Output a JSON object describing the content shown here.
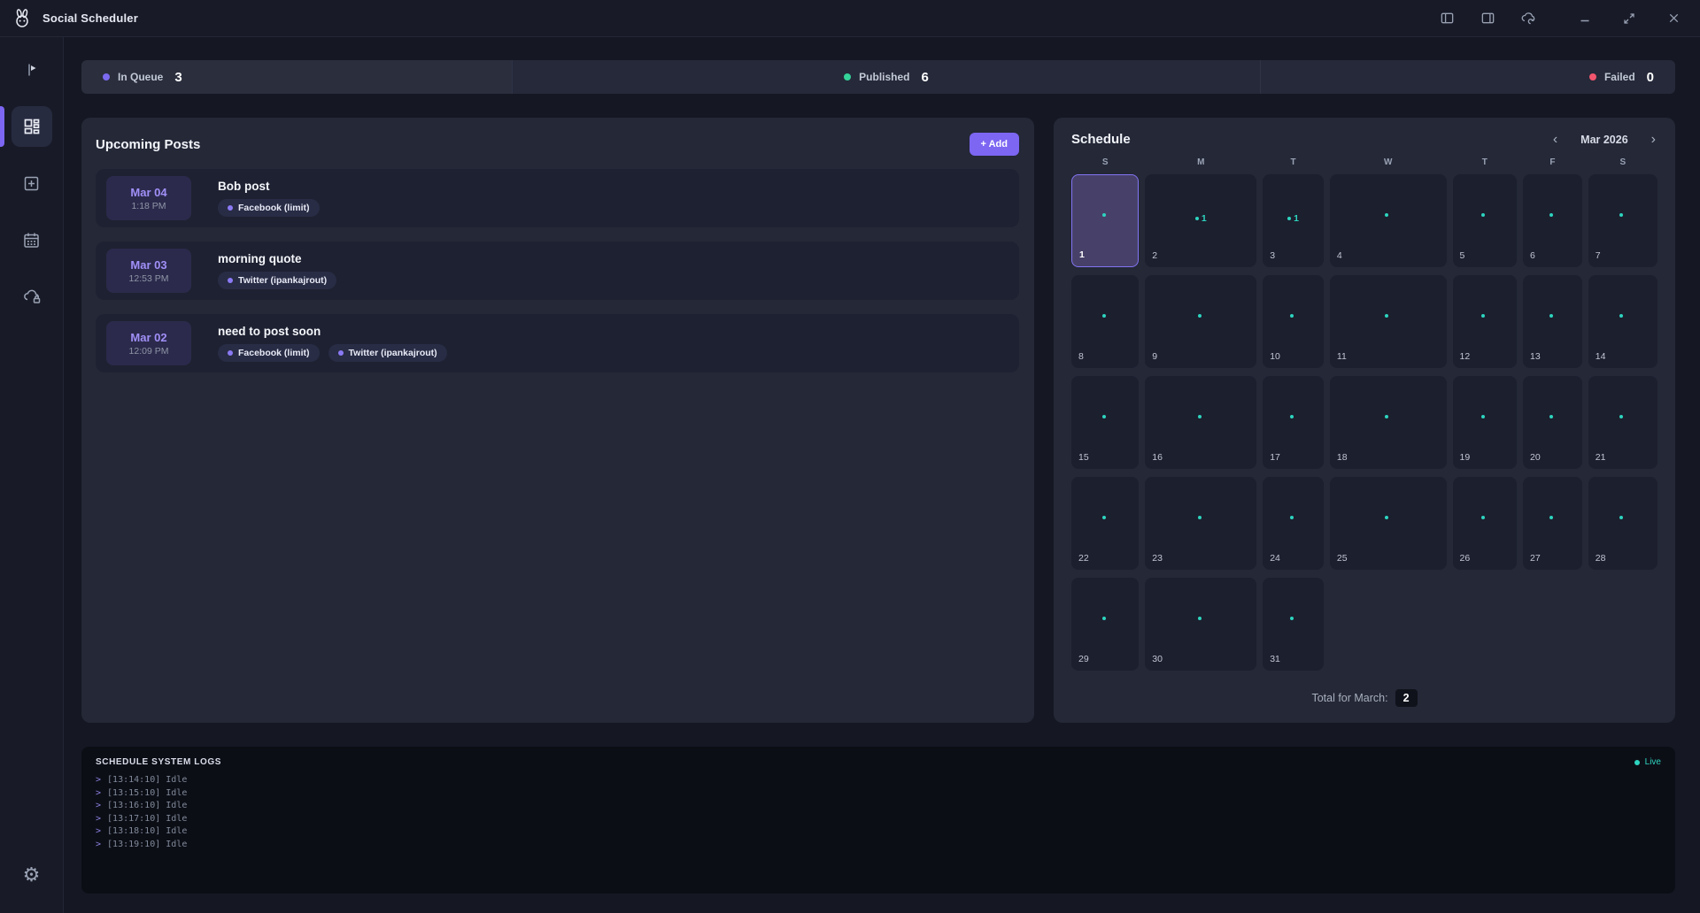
{
  "theme": {
    "accent": "#7c66f2",
    "queue_dot": "#7c6af0",
    "published_dot": "#34d399",
    "failed_dot": "#f2566e",
    "live_color": "#2dd4bf",
    "event_marker": "#2dd4bf"
  },
  "titlebar": {
    "app_title": "Social Scheduler"
  },
  "stats": {
    "items": [
      {
        "label": "In Queue",
        "value": "3"
      },
      {
        "label": "Published",
        "value": "6"
      },
      {
        "label": "Failed",
        "value": "0"
      }
    ]
  },
  "upcoming_posts": {
    "title": "Upcoming Posts",
    "add_button": "+ Add",
    "posts": [
      {
        "date": "Mar 04",
        "time": "1:18 PM",
        "title": "Bob post",
        "platforms": [
          "Facebook (limit)"
        ]
      },
      {
        "date": "Mar 03",
        "time": "12:53 PM",
        "title": "morning quote",
        "platforms": [
          "Twitter (ipankajrout)"
        ]
      },
      {
        "date": "Mar 02",
        "time": "12:09 PM",
        "title": "need to post soon",
        "platforms": [
          "Facebook (limit)",
          "Twitter (ipankajrout)"
        ]
      }
    ]
  },
  "schedule": {
    "title": "Schedule",
    "prev_icon": "‹",
    "next_icon": "›",
    "month_label": "Mar 2026",
    "day_headers": [
      "S",
      "M",
      "T",
      "W",
      "T",
      "F",
      "S"
    ],
    "days": [
      1,
      2,
      3,
      4,
      5,
      6,
      7,
      8,
      9,
      10,
      11,
      12,
      13,
      14,
      15,
      16,
      17,
      18,
      19,
      20,
      21,
      22,
      23,
      24,
      25,
      26,
      27,
      28,
      29,
      30,
      31
    ],
    "selected_day": 1,
    "events": [
      {
        "day": 2,
        "count": "1"
      },
      {
        "day": 3,
        "count": "1"
      }
    ],
    "total_label": "Total for March:",
    "total_value": "2"
  },
  "logs": {
    "title": "SCHEDULE SYSTEM LOGS",
    "live_label": "Live",
    "prompt": ">",
    "lines": [
      {
        "time": "[13:14:10]",
        "msg": "Idle"
      },
      {
        "time": "[13:15:10]",
        "msg": "Idle"
      },
      {
        "time": "[13:16:10]",
        "msg": "Idle"
      },
      {
        "time": "[13:17:10]",
        "msg": "Idle"
      },
      {
        "time": "[13:18:10]",
        "msg": "Idle"
      },
      {
        "time": "[13:19:10]",
        "msg": "Idle"
      }
    ]
  }
}
